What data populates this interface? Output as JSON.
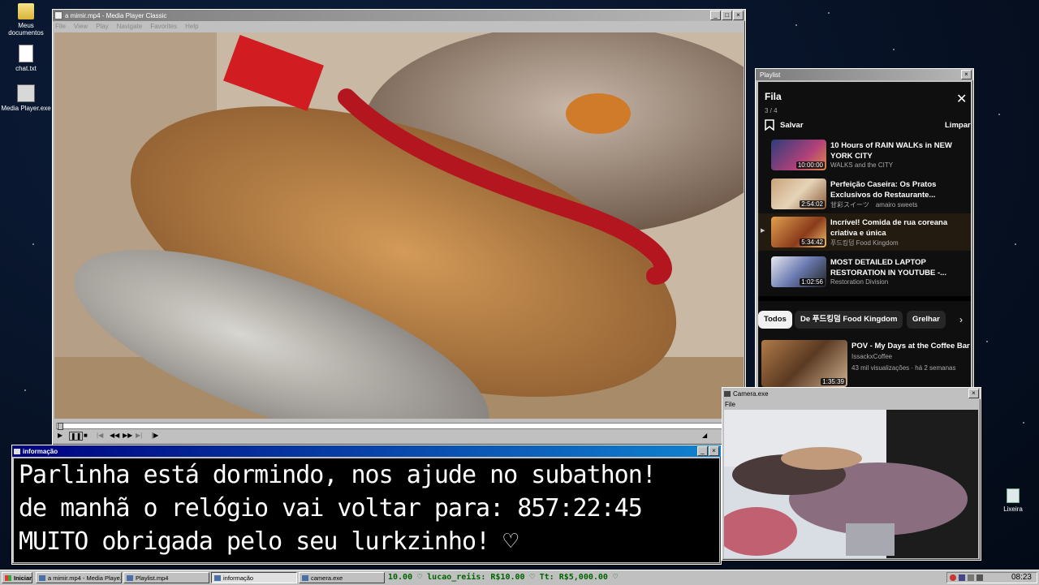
{
  "desktop": {
    "icons": [
      {
        "label": "Meus documentos"
      },
      {
        "label": "chat.txt"
      },
      {
        "label": "Media Player.exe"
      },
      {
        "label": "Lixeira"
      }
    ]
  },
  "media_player": {
    "title": "a mimir.mp4 - Media Player Classic",
    "menu": [
      "File",
      "View",
      "Play",
      "Navigate",
      "Favorites",
      "Help"
    ]
  },
  "playlist_window": {
    "title": "Playlist",
    "heading": "Fila",
    "position": "3 / 4",
    "save_label": "Salvar",
    "clear_label": "Limpar",
    "queue": [
      {
        "title": "10 Hours of RAIN WALKs in NEW YORK CITY",
        "channel": "WALKS and the CITY",
        "duration": "10:00:00"
      },
      {
        "title": "Perfeição Caseira: Os Pratos Exclusivos do Restaurante...",
        "channel": "甘彩スイーツ　amairo sweets",
        "duration": "2:54:02"
      },
      {
        "title": "Incrível! Comida de rua coreana criativa e única",
        "channel": "푸드킹덤 Food Kingdom",
        "duration": "5:34:42"
      },
      {
        "title": "MOST DETAILED LAPTOP RESTORATION IN YOUTUBE -...",
        "channel": "Restoration Division",
        "duration": "1:02:56"
      }
    ],
    "chips": [
      "Todos",
      "De 푸드킹덤 Food Kingdom",
      "Grelhar"
    ],
    "recommended": {
      "title": "POV - My Days at the Coffee Bar",
      "channel": "IssackxCoffee",
      "meta": "43 mil visualizações · há 2 semanas",
      "duration": "1:35:39"
    }
  },
  "camera_window": {
    "title": "Camera.exe",
    "menu": "File"
  },
  "info_window": {
    "title": "informação",
    "lines": [
      "Parlinha está dormindo, nos ajude no subathon!",
      "de manhã o relógio vai voltar para:  857:22:45",
      "MUITO obrigada pelo seu lurkzinho! ♡"
    ]
  },
  "taskbar": {
    "start": "Iniciar",
    "tasks": [
      "a mimir.mp4 - Media Playe...",
      "Playlist.mp4",
      "informação",
      "camera.exe"
    ],
    "ticker": "10.00 ♡  lucao_reiis: R$10.00 ♡  Tt: R$5,000.00 ♡",
    "clock": "08:23"
  },
  "colors": {
    "youtube_bg": "#0f0f0f",
    "title_active": "#000080",
    "win_gray": "#c0c0c0",
    "ticker_green": "#006400"
  }
}
